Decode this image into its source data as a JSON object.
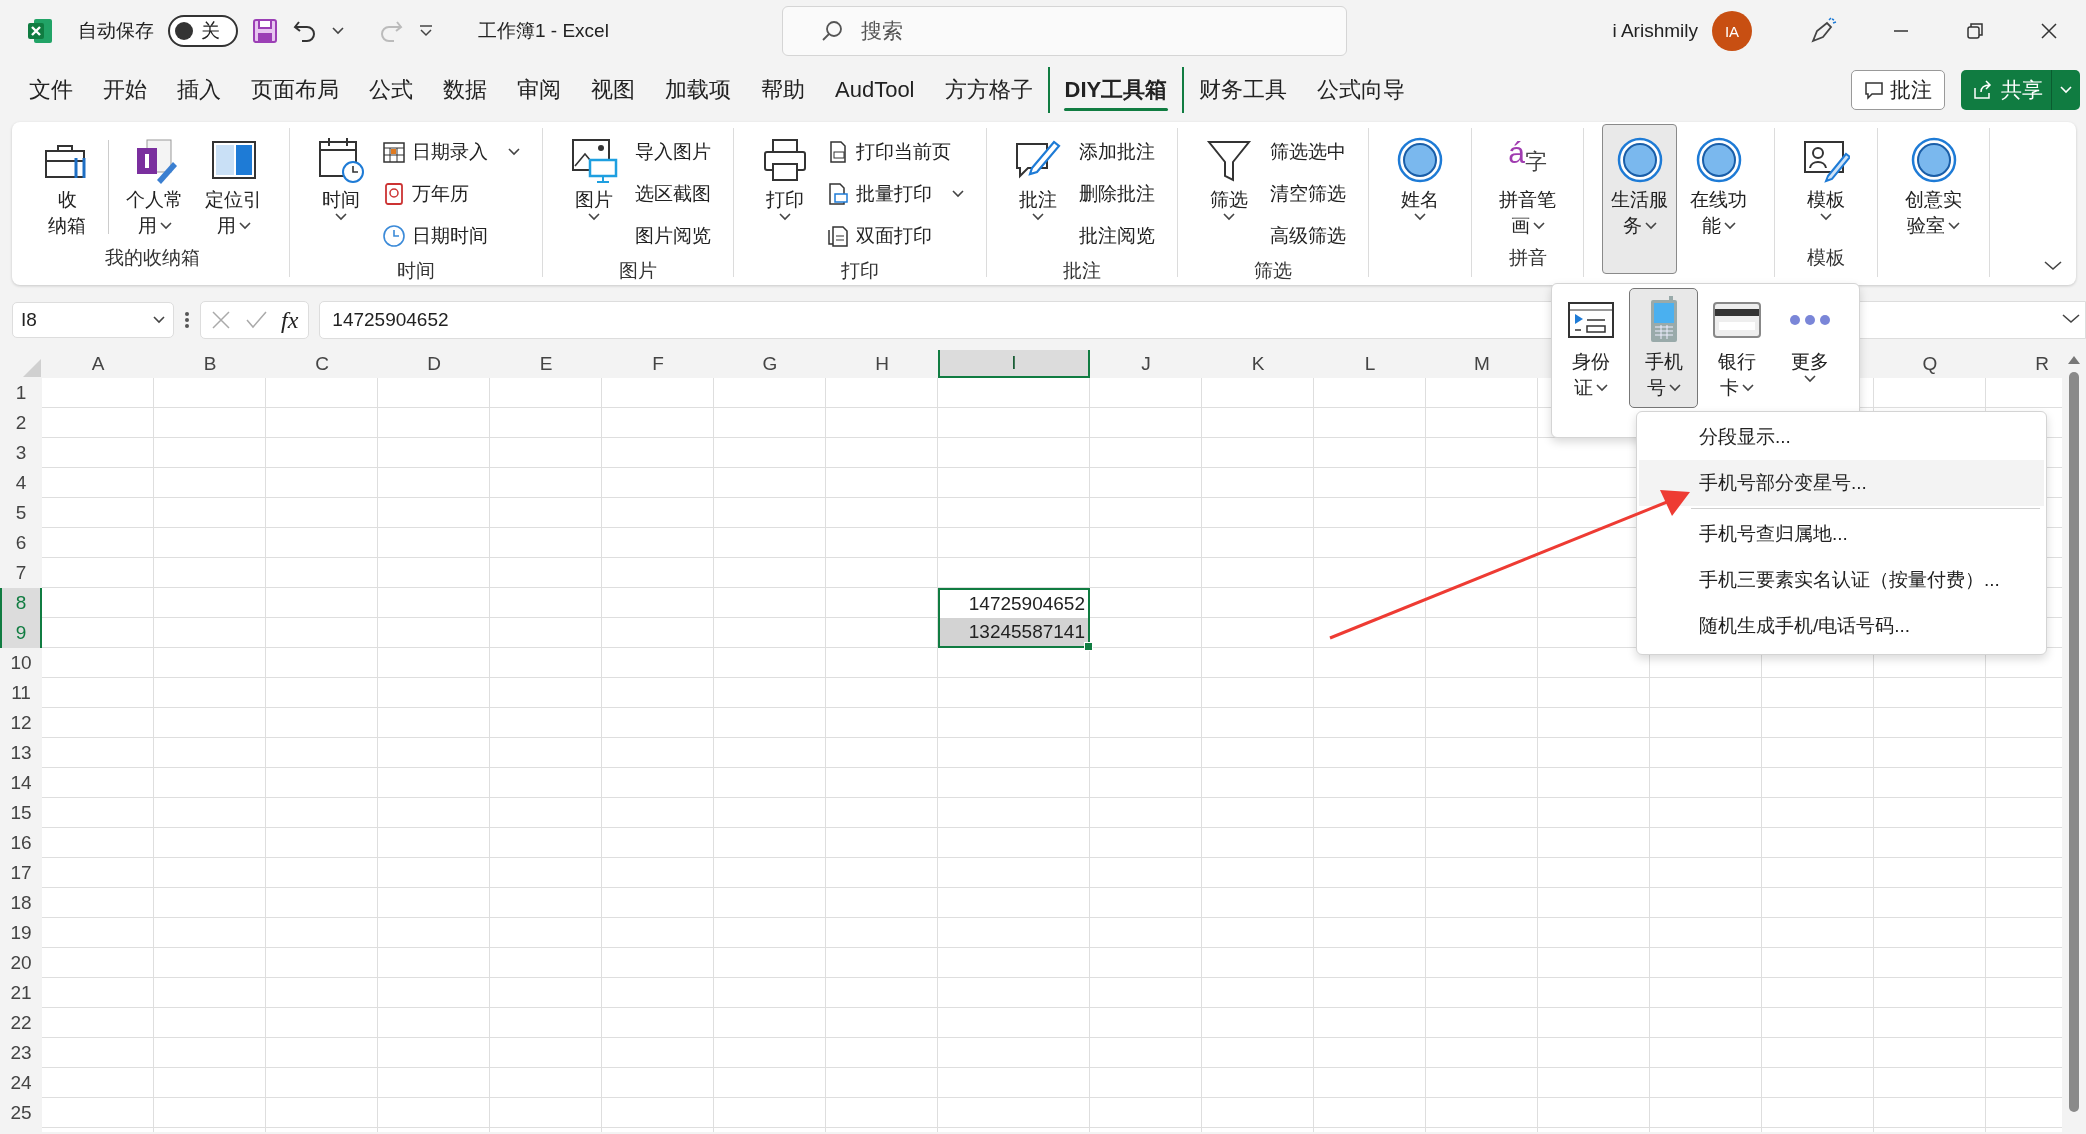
{
  "title_bar": {
    "autosave_label": "自动保存",
    "autosave_toggle": {
      "label": "关",
      "on": false
    },
    "title": "工作簿1 - Excel",
    "search": {
      "placeholder": "搜索"
    },
    "user_name": "i Arishmily",
    "avatar_initials": "IA"
  },
  "tabs": [
    {
      "label": "文件",
      "selected": false
    },
    {
      "label": "开始",
      "selected": false
    },
    {
      "label": "插入",
      "selected": false
    },
    {
      "label": "页面布局",
      "selected": false
    },
    {
      "label": "公式",
      "selected": false
    },
    {
      "label": "数据",
      "selected": false
    },
    {
      "label": "审阅",
      "selected": false
    },
    {
      "label": "视图",
      "selected": false
    },
    {
      "label": "加载项",
      "selected": false
    },
    {
      "label": "帮助",
      "selected": false
    },
    {
      "label": "AudTool",
      "selected": false
    },
    {
      "label": "方方格子",
      "selected": false
    },
    {
      "label": "DIY工具箱",
      "selected": true
    },
    {
      "label": "财务工具",
      "selected": false
    },
    {
      "label": "公式向导",
      "selected": false
    }
  ],
  "comment_button": "批注",
  "share_button": "共享",
  "ribbon": {
    "groups": [
      {
        "label": "我的收纳箱",
        "items": [
          {
            "kind": "large",
            "lines": [
              "收",
              "纳箱"
            ],
            "dropdown": false,
            "pressed": false
          },
          {
            "kind": "divider"
          },
          {
            "kind": "large",
            "lines": [
              "个人常",
              "用"
            ],
            "dropdown": true,
            "pressed": false
          },
          {
            "kind": "large",
            "lines": [
              "定位引",
              "用"
            ],
            "dropdown": true,
            "pressed": false
          }
        ]
      },
      {
        "label": "时间",
        "items": [
          {
            "kind": "large",
            "lines": [
              "时间"
            ],
            "dropdown": true,
            "pressed": false
          },
          {
            "kind": "stack",
            "entries": [
              {
                "label": "日期录入",
                "dropdown": true,
                "icon": true
              },
              {
                "label": "万年历",
                "dropdown": false,
                "icon": true
              },
              {
                "label": "日期时间",
                "dropdown": false,
                "icon": true
              }
            ]
          }
        ]
      },
      {
        "label": "图片",
        "items": [
          {
            "kind": "large",
            "lines": [
              "图片"
            ],
            "dropdown": true,
            "pressed": false
          },
          {
            "kind": "stack",
            "entries": [
              {
                "label": "导入图片",
                "dropdown": false,
                "icon": false
              },
              {
                "label": "选区截图",
                "dropdown": false,
                "icon": false
              },
              {
                "label": "图片阅览",
                "dropdown": false,
                "icon": false
              }
            ]
          }
        ]
      },
      {
        "label": "打印",
        "items": [
          {
            "kind": "large",
            "lines": [
              "打印"
            ],
            "dropdown": true,
            "pressed": false
          },
          {
            "kind": "stack",
            "entries": [
              {
                "label": "打印当前页",
                "dropdown": false,
                "icon": true
              },
              {
                "label": "批量打印",
                "dropdown": true,
                "icon": true
              },
              {
                "label": "双面打印",
                "dropdown": false,
                "icon": true
              }
            ]
          }
        ]
      },
      {
        "label": "批注",
        "items": [
          {
            "kind": "large",
            "lines": [
              "批注"
            ],
            "dropdown": true,
            "pressed": false
          },
          {
            "kind": "stack",
            "entries": [
              {
                "label": "添加批注",
                "dropdown": false,
                "icon": false
              },
              {
                "label": "删除批注",
                "dropdown": false,
                "icon": false
              },
              {
                "label": "批注阅览",
                "dropdown": false,
                "icon": false
              }
            ]
          }
        ]
      },
      {
        "label": "筛选",
        "items": [
          {
            "kind": "large",
            "lines": [
              "筛选"
            ],
            "dropdown": true,
            "pressed": false
          },
          {
            "kind": "stack",
            "entries": [
              {
                "label": "筛选选中",
                "dropdown": false,
                "icon": false
              },
              {
                "label": "清空筛选",
                "dropdown": false,
                "icon": false
              },
              {
                "label": "高级筛选",
                "dropdown": false,
                "icon": false
              }
            ]
          }
        ]
      },
      {
        "items": [
          {
            "kind": "large",
            "lines": [
              "姓名"
            ],
            "dropdown": true,
            "pressed": false
          }
        ]
      },
      {
        "label": "拼音",
        "items": [
          {
            "kind": "large",
            "lines": [
              "拼音笔",
              "画"
            ],
            "dropdown": true,
            "pressed": false,
            "icon_letters": [
              "á",
              "字"
            ]
          }
        ]
      },
      {
        "items": [
          {
            "kind": "large",
            "lines": [
              "生活服",
              "务"
            ],
            "dropdown": true,
            "pressed": true
          },
          {
            "kind": "large",
            "lines": [
              "在线功",
              "能"
            ],
            "dropdown": true,
            "pressed": false
          }
        ]
      },
      {
        "label": "模板",
        "items": [
          {
            "kind": "large",
            "lines": [
              "模板"
            ],
            "dropdown": true,
            "pressed": false
          }
        ]
      },
      {
        "items": [
          {
            "kind": "large",
            "lines": [
              "创意实",
              "验室"
            ],
            "dropdown": true,
            "pressed": false
          }
        ]
      }
    ]
  },
  "formula_bar": {
    "name_box": "I8",
    "function_label": "fx",
    "formula": "14725904652"
  },
  "sheet": {
    "columns": [
      {
        "label": "A",
        "selected": false
      },
      {
        "label": "B",
        "selected": false
      },
      {
        "label": "C",
        "selected": false
      },
      {
        "label": "D",
        "selected": false
      },
      {
        "label": "E",
        "selected": false
      },
      {
        "label": "F",
        "selected": false
      },
      {
        "label": "G",
        "selected": false
      },
      {
        "label": "H",
        "selected": false
      },
      {
        "label": "I",
        "selected": true
      },
      {
        "label": "J",
        "selected": false
      },
      {
        "label": "K",
        "selected": false
      },
      {
        "label": "L",
        "selected": false
      },
      {
        "label": "M",
        "selected": false
      },
      {
        "label": "Q",
        "selected": false
      },
      {
        "label": "R",
        "selected": false
      }
    ],
    "rows": [
      {
        "label": "1",
        "selected": false
      },
      {
        "label": "2",
        "selected": false
      },
      {
        "label": "3",
        "selected": false
      },
      {
        "label": "4",
        "selected": false
      },
      {
        "label": "5",
        "selected": false
      },
      {
        "label": "6",
        "selected": false
      },
      {
        "label": "7",
        "selected": false
      },
      {
        "label": "8",
        "selected": true
      },
      {
        "label": "9",
        "selected": true
      },
      {
        "label": "10",
        "selected": false
      },
      {
        "label": "11",
        "selected": false
      },
      {
        "label": "12",
        "selected": false
      },
      {
        "label": "13",
        "selected": false
      },
      {
        "label": "14",
        "selected": false
      },
      {
        "label": "15",
        "selected": false
      },
      {
        "label": "16",
        "selected": false
      },
      {
        "label": "17",
        "selected": false
      },
      {
        "label": "18",
        "selected": false
      },
      {
        "label": "19",
        "selected": false
      },
      {
        "label": "20",
        "selected": false
      },
      {
        "label": "21",
        "selected": false
      },
      {
        "label": "22",
        "selected": false
      },
      {
        "label": "23",
        "selected": false
      },
      {
        "label": "24",
        "selected": false
      },
      {
        "label": "25",
        "selected": false
      }
    ],
    "selection_cells": [
      {
        "value": "14725904652",
        "active": true
      },
      {
        "value": "13245587141",
        "active": false
      }
    ]
  },
  "life_service_panel": {
    "items": [
      {
        "lines": [
          "身份",
          "证"
        ],
        "pressed": false
      },
      {
        "lines": [
          "手机",
          "号"
        ],
        "pressed": true
      },
      {
        "lines": [
          "银行",
          "卡"
        ],
        "pressed": false
      },
      {
        "lines": [
          "更多"
        ],
        "pressed": false
      }
    ]
  },
  "phone_menu": {
    "items": [
      {
        "label": "分段显示...",
        "highlighted": false,
        "divider_after": false
      },
      {
        "label": "手机号部分变星号...",
        "highlighted": true,
        "divider_after": true
      },
      {
        "label": "手机号查归属地...",
        "highlighted": false,
        "divider_after": false
      },
      {
        "label": "手机三要素实名认证（按量付费）...",
        "highlighted": false,
        "divider_after": false
      },
      {
        "label": "随机生成手机/电话号码...",
        "highlighted": false,
        "divider_after": false
      }
    ]
  }
}
